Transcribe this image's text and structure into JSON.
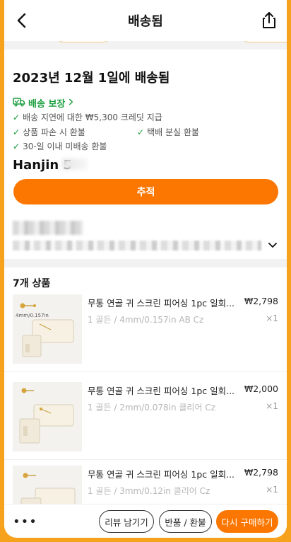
{
  "header": {
    "title": "배송됨",
    "back_icon": "back-arrow-icon",
    "share_icon": "share-icon"
  },
  "delivery": {
    "title": "2023년 12월 1일에 배송됨",
    "guarantee_label": "배송 보장",
    "guarantees": [
      "배송 지연에 대한 ₩5,300 크레딧 지급",
      "상품 파손 시 환불",
      "택배 분실 환불",
      "30-일 이내 미배송 환불"
    ],
    "carrier": "Hanjin 5",
    "track_button": "추적"
  },
  "products": {
    "count_label": "7개 상품",
    "items": [
      {
        "name": "무통 연골 귀 스크린 피어싱 1pc 일회...",
        "price": "₩2,798",
        "variant": "1 골든 / 4mm/0.157in AB Cz",
        "qty": "×1",
        "thumb_label": "4mm/0.157in"
      },
      {
        "name": "무통 연골 귀 스크린 피어싱 1pc 일회...",
        "price": "₩2,000",
        "variant": "1 골든 / 2mm/0.078in 클리어 Cz",
        "qty": "×1",
        "thumb_label": ""
      },
      {
        "name": "무통 연골 귀 스크린 피어싱 1pc 일회...",
        "price": "₩2,798",
        "variant": "1 골든 / 3mm/0.12in 클리어 Cz",
        "qty": "×1",
        "thumb_label": ""
      }
    ]
  },
  "bottom_bar": {
    "more": "•••",
    "review_button": "리뷰 남기기",
    "return_button": "반품 / 환불",
    "rebuy_button": "다시 구매하기"
  },
  "colors": {
    "accent": "#fb7701",
    "frame": "#f7a21c",
    "guarantee_green": "#1a9e3e"
  }
}
